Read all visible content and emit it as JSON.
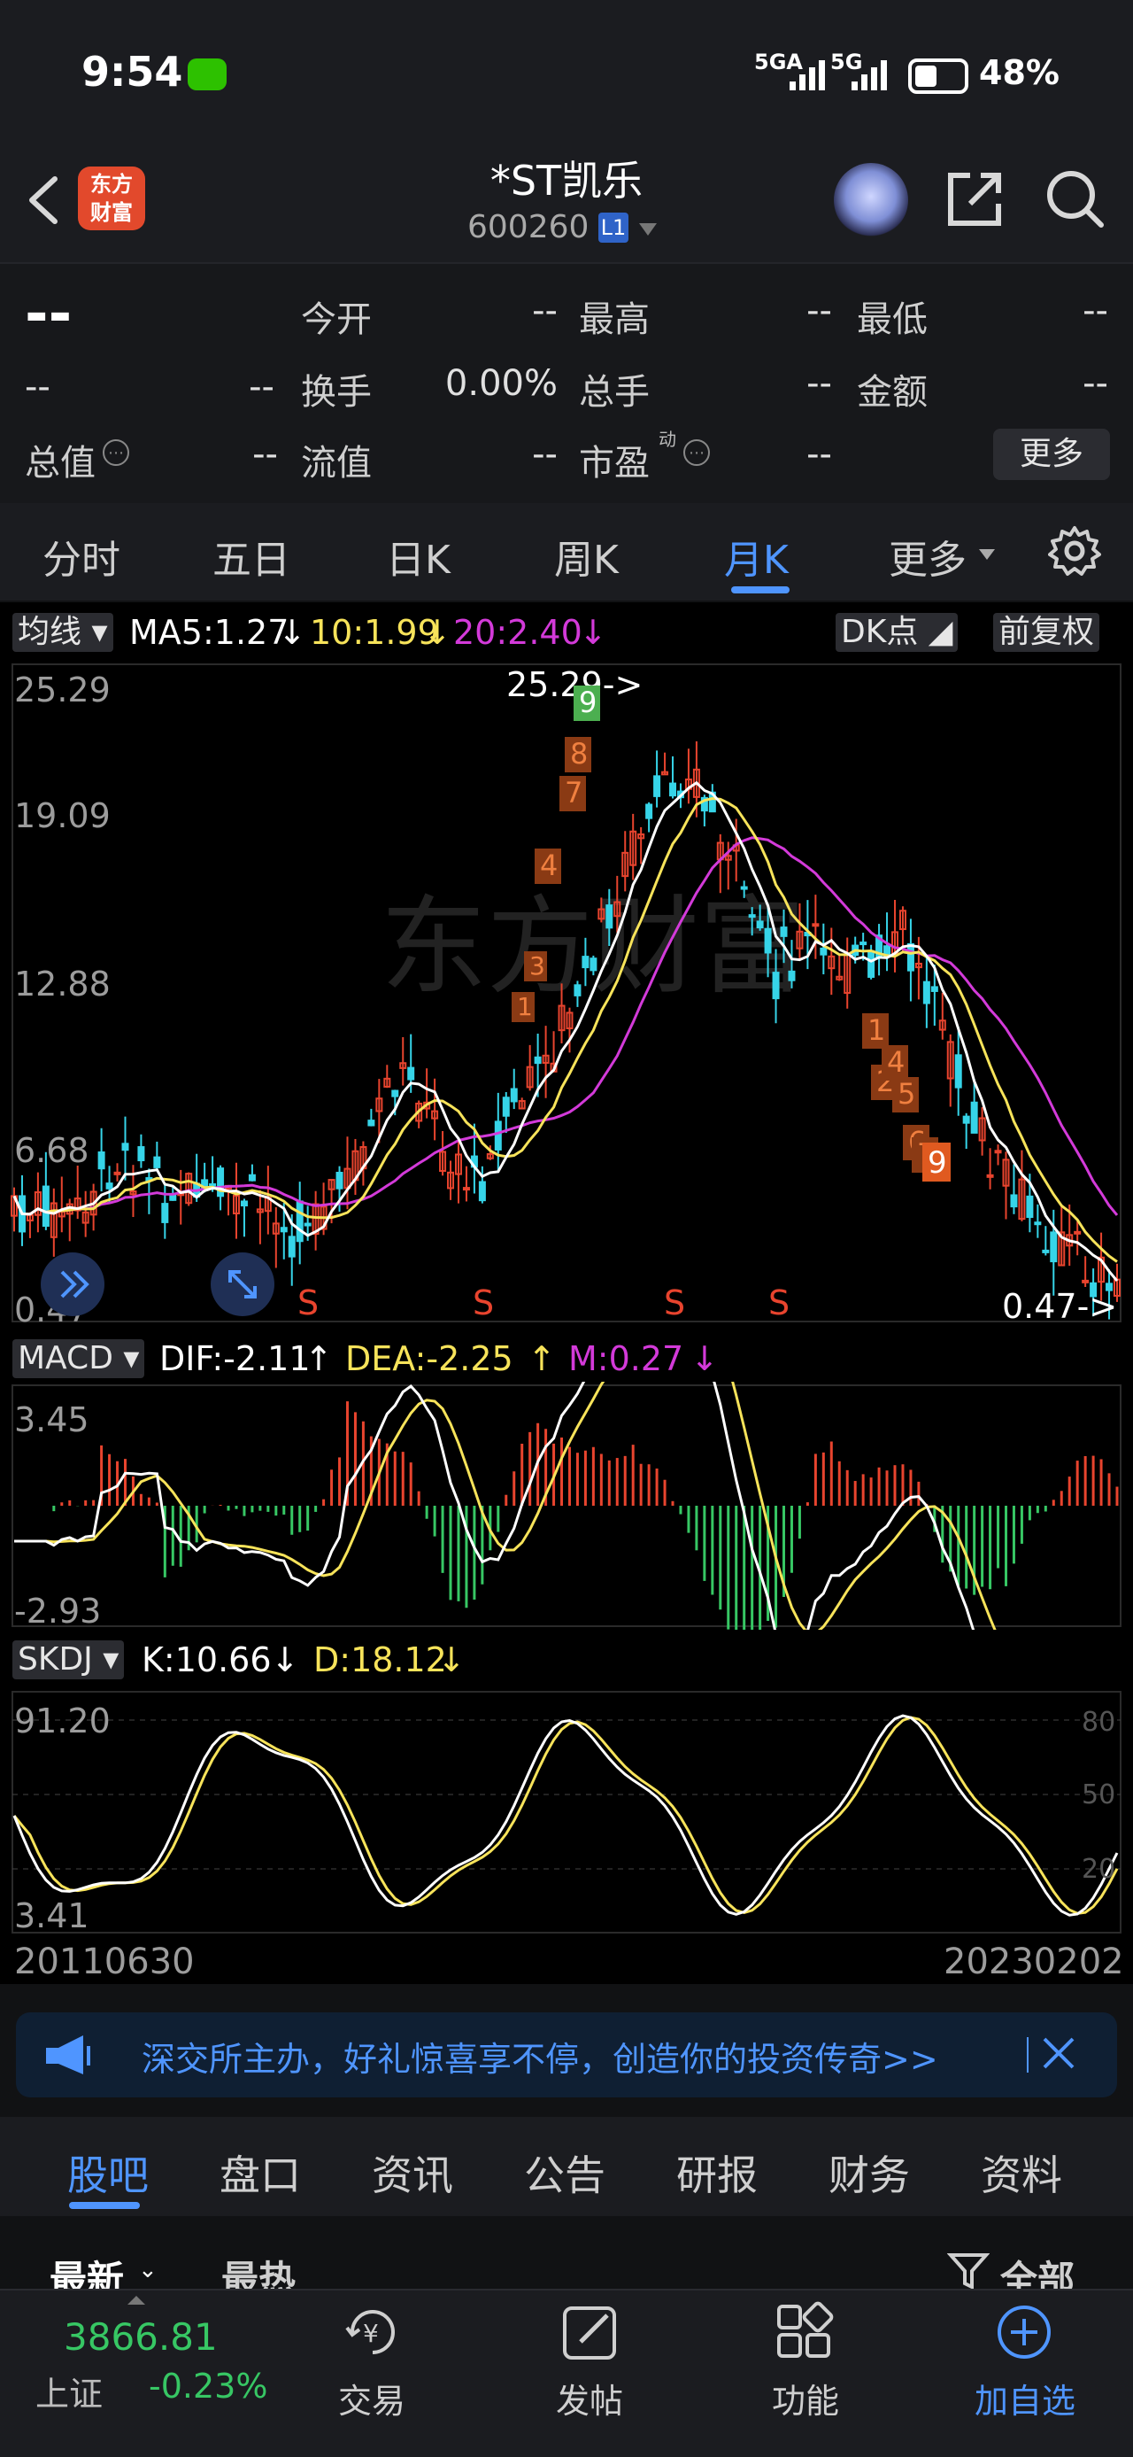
{
  "status": {
    "time": "9:54",
    "sig1": "5GA",
    "sig2": "5G",
    "battery": "48%"
  },
  "header": {
    "back": "",
    "logo_line1": "东方",
    "logo_line2": "财富",
    "title": "*ST凯乐",
    "code": "600260",
    "badge": "L1"
  },
  "quote": {
    "price": "--",
    "change1": "--",
    "change2": "--",
    "fields": [
      {
        "label": "今开",
        "value": "--"
      },
      {
        "label": "最高",
        "value": "--"
      },
      {
        "label": "最低",
        "value": "--"
      },
      {
        "label": "换手",
        "value": "0.00%"
      },
      {
        "label": "总手",
        "value": "--"
      },
      {
        "label": "金额",
        "value": "--"
      },
      {
        "label": "总值",
        "value": "--"
      },
      {
        "label": "流值",
        "value": "--"
      },
      {
        "label": "市盈",
        "value": "--",
        "sup": "动"
      }
    ],
    "more": "更多"
  },
  "tabs": [
    "分时",
    "五日",
    "日K",
    "周K",
    "月K",
    "更多"
  ],
  "active_tab": "月K",
  "main_chart": {
    "indicator": "均线",
    "ma5": "MA5:1.27",
    "ma10": "10:1.99",
    "ma20": "20:2.40",
    "dk": "DK点",
    "fq": "前复权",
    "y_top": "25.29",
    "y_2": "19.09",
    "y_3": "12.88",
    "y_4": "6.68",
    "y_bottom": "0.47",
    "max_label": "25.29->",
    "min_label": "0.47->",
    "s_marks": [
      "S",
      "S",
      "S",
      "S"
    ],
    "watermark": "东方财富",
    "td_up": [
      "1",
      "3",
      "4",
      "7",
      "8",
      "9"
    ],
    "td_down": [
      "1",
      "2",
      "4",
      "5",
      "6",
      "7",
      "9"
    ]
  },
  "macd": {
    "name": "MACD",
    "dif": "DIF:-2.11",
    "dea": "DEA:-2.25",
    "m": "M:0.27",
    "y_top": "3.45",
    "y_bottom": "-2.93"
  },
  "skdj": {
    "name": "SKDJ",
    "k": "K:10.66",
    "d": "D:18.12",
    "y_top": "91.20",
    "y_bottom": "3.41",
    "ref80": "80",
    "ref50": "50",
    "ref20": "20"
  },
  "dates": {
    "start": "20110630",
    "end": "20230202"
  },
  "colors": {
    "up": "#e8442e",
    "down": "#36d4e8",
    "ma5": "#ffffff",
    "ma10": "#f7e35a",
    "ma20": "#d33ad9",
    "green": "#37c764",
    "blue": "#4f95ff"
  },
  "banner": {
    "text": "深交所主办，好礼惊喜享不停，创造你的投资传奇>>"
  },
  "subtabs": [
    "股吧",
    "盘口",
    "资讯",
    "公告",
    "研报",
    "财务",
    "资料"
  ],
  "sort": {
    "latest": "最新",
    "hot": "最热",
    "all": "全部"
  },
  "bottom": {
    "index_value": "3866.81",
    "index_name": "上证",
    "index_change": "-0.23%",
    "nav": [
      "交易",
      "发帖",
      "功能",
      "加自选"
    ]
  }
}
